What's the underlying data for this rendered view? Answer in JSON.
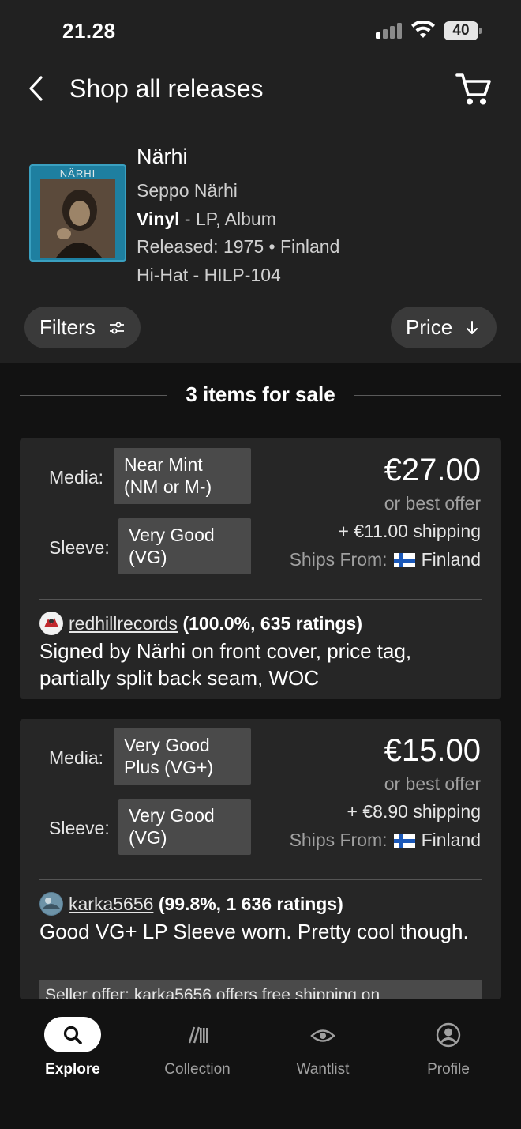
{
  "status_bar": {
    "time": "21.28",
    "battery": "40"
  },
  "header": {
    "title": "Shop all releases",
    "back_icon": "chevron-left-icon",
    "cart_icon": "shopping-cart-icon"
  },
  "release": {
    "title": "Närhi",
    "cover_text": "NÄRHI",
    "artist": "Seppo Närhi",
    "format_bold": "Vinyl",
    "format_rest": " - LP, Album",
    "released": "Released: 1975 • Finland",
    "label": "Hi-Hat - HILP-104"
  },
  "controls": {
    "filters": "Filters",
    "sort": "Price"
  },
  "items_header": "3 items for sale",
  "listings": [
    {
      "media_label": "Media:",
      "media_line1": "Near Mint",
      "media_line2": "(NM or M-)",
      "sleeve_label": "Sleeve:",
      "sleeve_line1": "Very Good",
      "sleeve_line2": "(VG)",
      "price": "€27.00",
      "offer": "or best offer",
      "shipping": "+ €11.00 shipping",
      "ships_from_label": "Ships From:",
      "ships_from": "Finland",
      "seller": "redhillrecords",
      "rating": "(100.0%, 635 ratings)",
      "comment": "Signed by Närhi on front cover, price tag, partially split back seam, WOC"
    },
    {
      "media_label": "Media:",
      "media_line1": "Very Good",
      "media_line2": "Plus (VG+)",
      "sleeve_label": "Sleeve:",
      "sleeve_line1": "Very Good",
      "sleeve_line2": "(VG)",
      "price": "€15.00",
      "offer": "or best offer",
      "shipping": "+ €8.90 shipping",
      "ships_from_label": "Ships From:",
      "ships_from": "Finland",
      "seller": "karka5656",
      "rating": "(99.8%, 1 636 ratings)",
      "comment": "Good VG+ LP Sleeve worn. Pretty cool though.",
      "seller_offer": "Seller offer: karka5656 offers free shipping on"
    }
  ],
  "nav": [
    {
      "label": "Explore",
      "icon": "search-icon",
      "active": true
    },
    {
      "label": "Collection",
      "icon": "collection-icon",
      "active": false
    },
    {
      "label": "Wantlist",
      "icon": "eye-icon",
      "active": false
    },
    {
      "label": "Profile",
      "icon": "profile-icon",
      "active": false
    }
  ]
}
